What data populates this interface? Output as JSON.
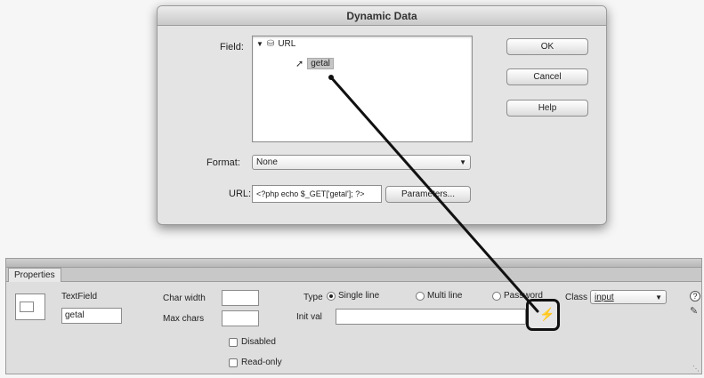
{
  "dialog": {
    "title": "Dynamic Data",
    "field_label": "Field:",
    "tree": {
      "root_toggle": "▼",
      "root_label": "URL",
      "child_label": "getal"
    },
    "format_label": "Format:",
    "format_value": "None",
    "url_label": "URL:",
    "url_value": "<?php echo $_GET['getal']; ?>",
    "parameters_label": "Parameters...",
    "ok_label": "OK",
    "cancel_label": "Cancel",
    "help_label": "Help"
  },
  "panel": {
    "tab_label": "Properties",
    "type_name": "TextField",
    "field_name": "getal",
    "char_width_label": "Char width",
    "char_width_value": "",
    "max_chars_label": "Max chars",
    "max_chars_value": "",
    "type_label": "Type",
    "type_options": [
      "Single line",
      "Multi line",
      "Password"
    ],
    "type_selected": "Single line",
    "init_val_label": "Init val",
    "init_val_value": "",
    "disabled_label": "Disabled",
    "readonly_label": "Read-only",
    "class_label": "Class",
    "class_value": "input"
  }
}
